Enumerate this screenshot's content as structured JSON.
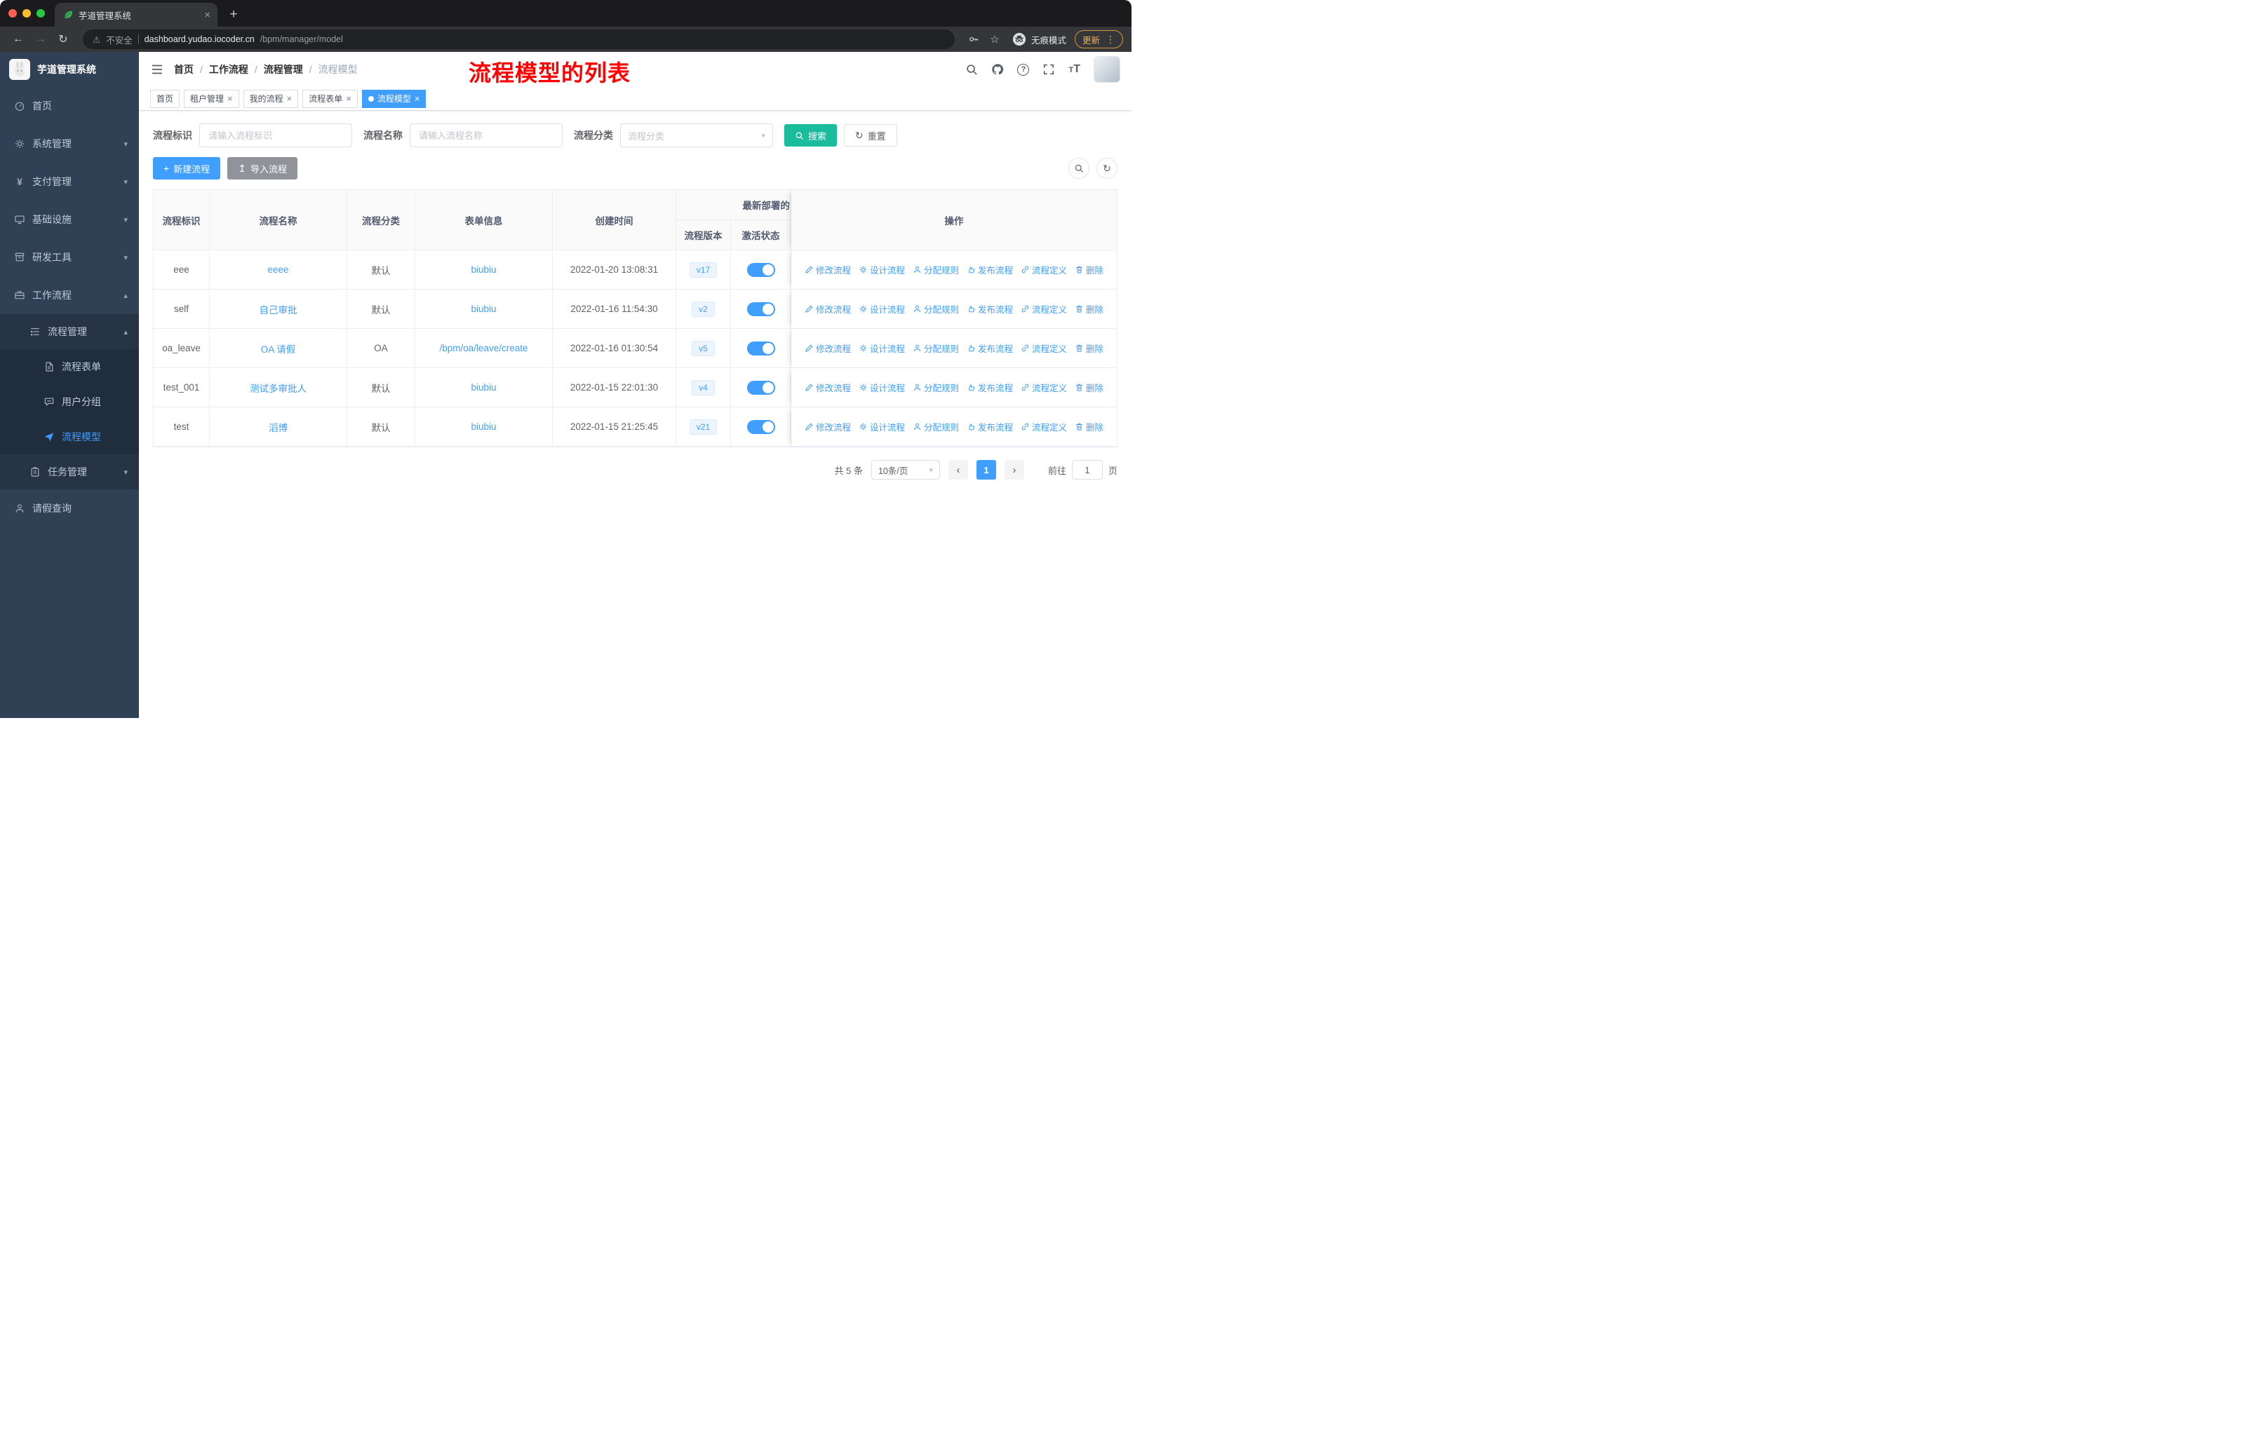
{
  "browser": {
    "tab_title": "芋道管理系统",
    "security_label": "不安全",
    "url_host": "dashboard.yudao.iocoder.cn",
    "url_path": "/bpm/manager/model",
    "incognito_label": "无痕模式",
    "update_label": "更新"
  },
  "icons": {
    "back": "←",
    "forward": "→",
    "reload": "↻",
    "warning": "⚠",
    "star": "☆",
    "dots": "⋮",
    "new_tab": "+",
    "close": "×",
    "chevron_down": "▾",
    "chevron_up": "▴",
    "select_caret": "▾",
    "plus": "+",
    "upload": "↥",
    "refresh": "↻",
    "prev": "‹",
    "next": "›",
    "question": "?",
    "yen": "¥",
    "font_size": "TT"
  },
  "sidebar": {
    "logo_title": "芋道管理系统",
    "items": {
      "home": "首页",
      "system": "系统管理",
      "payment": "支付管理",
      "infra": "基础设施",
      "dev_tools": "研发工具",
      "workflow": "工作流程",
      "process_mgmt": "流程管理",
      "process_form": "流程表单",
      "user_group": "用户分组",
      "process_model": "流程模型",
      "task_mgmt": "任务管理",
      "leave_query": "请假查询"
    }
  },
  "header": {
    "breadcrumb": [
      "首页",
      "工作流程",
      "流程管理",
      "流程模型"
    ],
    "separator": "/",
    "annotation": "流程模型的列表"
  },
  "tags": {
    "items": [
      "首页",
      "租户管理",
      "我的流程",
      "流程表单",
      "流程模型"
    ]
  },
  "filters": {
    "key_label": "流程标识",
    "key_placeholder": "请输入流程标识",
    "name_label": "流程名称",
    "name_placeholder": "请输入流程名称",
    "category_label": "流程分类",
    "category_placeholder": "流程分类",
    "search_label": "搜索",
    "reset_label": "重置"
  },
  "toolbar": {
    "create_label": "新建流程",
    "import_label": "导入流程"
  },
  "table": {
    "headers": {
      "key": "流程标识",
      "name": "流程名称",
      "category": "流程分类",
      "form": "表单信息",
      "created": "创建时间",
      "deploy_group": "最新部署的",
      "version": "流程版本",
      "status": "激活状态",
      "actions": "操作"
    },
    "action_labels": [
      "修改流程",
      "设计流程",
      "分配规则",
      "发布流程",
      "流程定义",
      "删除"
    ],
    "rows": [
      {
        "key": "eee",
        "name": "eeee",
        "category": "默认",
        "form": "biubiu",
        "created": "2022-01-20 13:08:31",
        "version": "v17"
      },
      {
        "key": "self",
        "name": "自己审批",
        "category": "默认",
        "form": "biubiu",
        "created": "2022-01-16 11:54:30",
        "version": "v2"
      },
      {
        "key": "oa_leave",
        "name": "OA 请假",
        "category": "OA",
        "form": "/bpm/oa/leave/create",
        "created": "2022-01-16 01:30:54",
        "version": "v5"
      },
      {
        "key": "test_001",
        "name": "测试多审批人",
        "category": "默认",
        "form": "biubiu",
        "created": "2022-01-15 22:01:30",
        "version": "v4"
      },
      {
        "key": "test",
        "name": "滔博",
        "category": "默认",
        "form": "biubiu",
        "created": "2022-01-15 21:25:45",
        "version": "v21"
      }
    ]
  },
  "pagination": {
    "total": "共 5 条",
    "page_size": "10条/页",
    "current_page": "1",
    "goto_label": "前往",
    "goto_value": "1",
    "page_unit": "页"
  },
  "colors": {
    "accent": "#409EFF",
    "search_button": "#1ABC9C",
    "annotation": "#FE0100",
    "sidebar_bg": "#304156",
    "toggle_on": "#409EFF"
  }
}
